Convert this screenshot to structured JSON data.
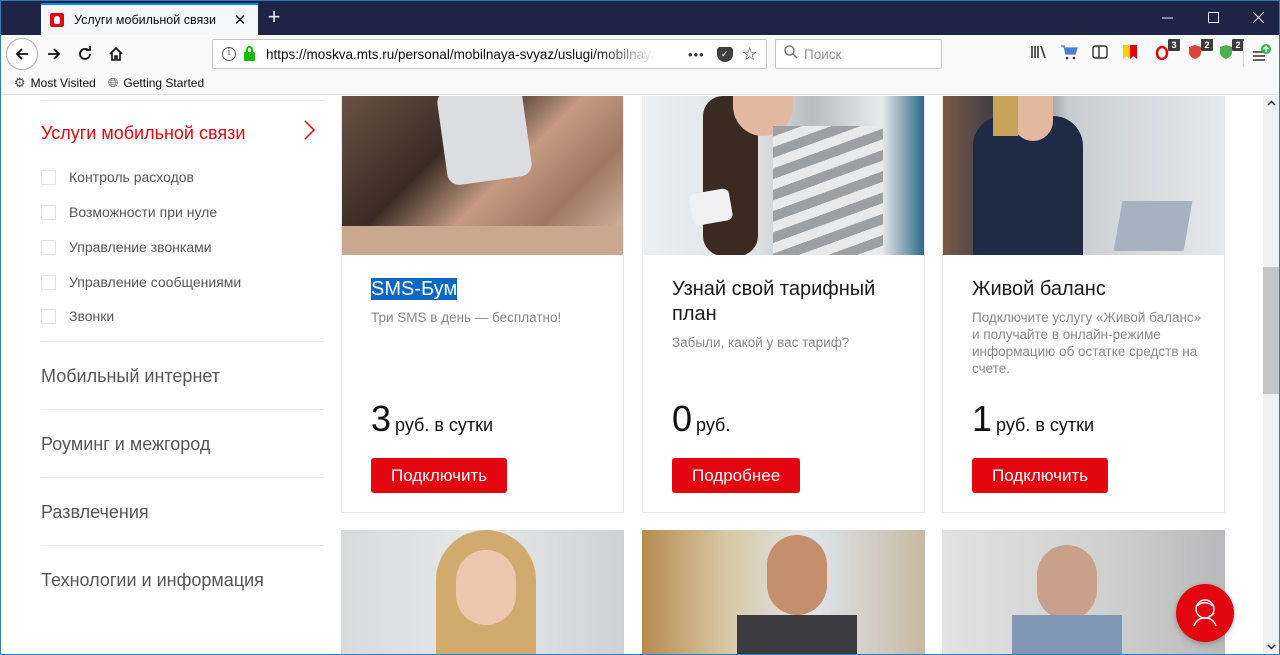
{
  "browser": {
    "tab_title": "Услуги мобильной связи",
    "tab_close": "✕",
    "new_tab": "+",
    "window_controls": {
      "minimize": "—",
      "maximize": "☐",
      "close": "✕"
    },
    "url": "https://moskva.mts.ru/personal/mobilnaya-svyaz/uslugi/mobilnaya",
    "page_actions": "•••",
    "search_placeholder": "Поиск",
    "bookmarks": [
      {
        "label": "Most Visited",
        "icon": "gear-icon"
      },
      {
        "label": "Getting Started",
        "icon": "globe-icon"
      }
    ],
    "toolbar_badges": {
      "opera_icon": "3",
      "shield_red": "2",
      "shield_green": "2"
    }
  },
  "sidebar": {
    "active_section": "Услуги мобильной связи",
    "sub_items": [
      "Контроль расходов",
      "Возможности при нуле",
      "Управление звонками",
      "Управление сообщениями",
      "Звонки"
    ],
    "sections": [
      "Мобильный интернет",
      "Роуминг и межгород",
      "Развлечения",
      "Технологии и информация"
    ]
  },
  "cards": [
    {
      "title": "SMS-Бум",
      "title_selected": true,
      "description": "Три SMS в день — бесплатно!",
      "price_value": "3",
      "price_unit": "руб. в сутки",
      "button": "Подключить"
    },
    {
      "title": "Узнай свой тарифный план",
      "title_selected": false,
      "description": "Забыли, какой у вас тариф?",
      "price_value": "0",
      "price_unit": "руб.",
      "button": "Подробнее"
    },
    {
      "title": "Живой баланс",
      "title_selected": false,
      "description": "Подключите услугу «Живой баланс» и получайте в онлайн-режиме информацию об остатке средств на счете.",
      "price_value": "1",
      "price_unit": "руб. в сутки",
      "button": "Подключить"
    }
  ],
  "colors": {
    "brand_red": "#e30611",
    "selection_blue": "#0b67c6"
  }
}
